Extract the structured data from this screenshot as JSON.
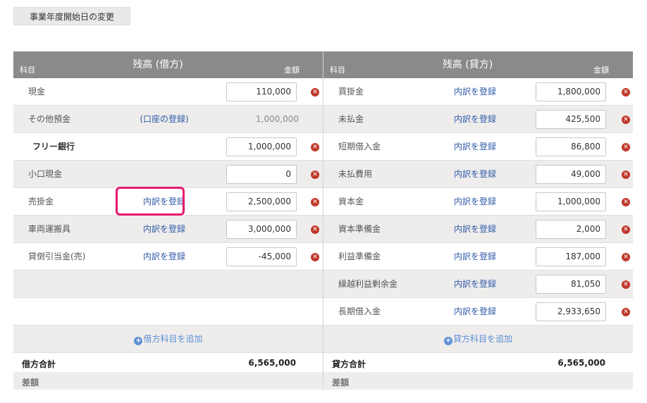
{
  "top_button": {
    "label": "事業年度開始日の変更"
  },
  "debit": {
    "header": {
      "subject": "科目",
      "title": "残高 (借方)",
      "amount": "金額"
    },
    "rows": [
      {
        "name": "現金",
        "link": "",
        "amount": "110,000",
        "input": true
      },
      {
        "name": "その他預金",
        "link": "(口座の登録)",
        "amount": "1,000,000",
        "input": false
      },
      {
        "name": "フリー銀行",
        "link": "",
        "amount": "1,000,000",
        "input": true,
        "bold": true
      },
      {
        "name": "小口現金",
        "link": "",
        "amount": "0",
        "input": true
      },
      {
        "name": "売掛金",
        "link": "内訳を登録",
        "amount": "2,500,000",
        "input": true
      },
      {
        "name": "車両運搬具",
        "link": "内訳を登録",
        "amount": "3,000,000",
        "input": true
      },
      {
        "name": "貸倒引当金(売)",
        "link": "内訳を登録",
        "amount": "-45,000",
        "input": true
      }
    ],
    "add_label": "借方科目を追加",
    "total_label": "借方合計",
    "total_value": "6,565,000",
    "diff_label": "差額"
  },
  "credit": {
    "header": {
      "subject": "科目",
      "title": "残高 (貸方)",
      "amount": "金額"
    },
    "rows": [
      {
        "name": "買掛金",
        "link": "内訳を登録",
        "amount": "1,800,000"
      },
      {
        "name": "未払金",
        "link": "内訳を登録",
        "amount": "425,500"
      },
      {
        "name": "短期借入金",
        "link": "内訳を登録",
        "amount": "86,800"
      },
      {
        "name": "未払費用",
        "link": "内訳を登録",
        "amount": "49,000"
      },
      {
        "name": "資本金",
        "link": "内訳を登録",
        "amount": "1,000,000"
      },
      {
        "name": "資本準備金",
        "link": "内訳を登録",
        "amount": "2,000"
      },
      {
        "name": "利益準備金",
        "link": "内訳を登録",
        "amount": "187,000"
      },
      {
        "name": "繰越利益剰余金",
        "link": "内訳を登録",
        "amount": "81,050"
      },
      {
        "name": "長期借入金",
        "link": "内訳を登録",
        "amount": "2,933,650"
      }
    ],
    "add_label": "貸方科目を追加",
    "total_label": "貸方合計",
    "total_value": "6,565,000",
    "diff_label": "差額"
  },
  "icons": {
    "delete": "delete-circle-icon",
    "add": "plus-circle-icon"
  },
  "colors": {
    "header_bg": "#8c8a88",
    "link": "#2f5aa8",
    "delete": "#c0392b",
    "highlight": "#e6196e",
    "add_link": "#5b8fd6"
  }
}
